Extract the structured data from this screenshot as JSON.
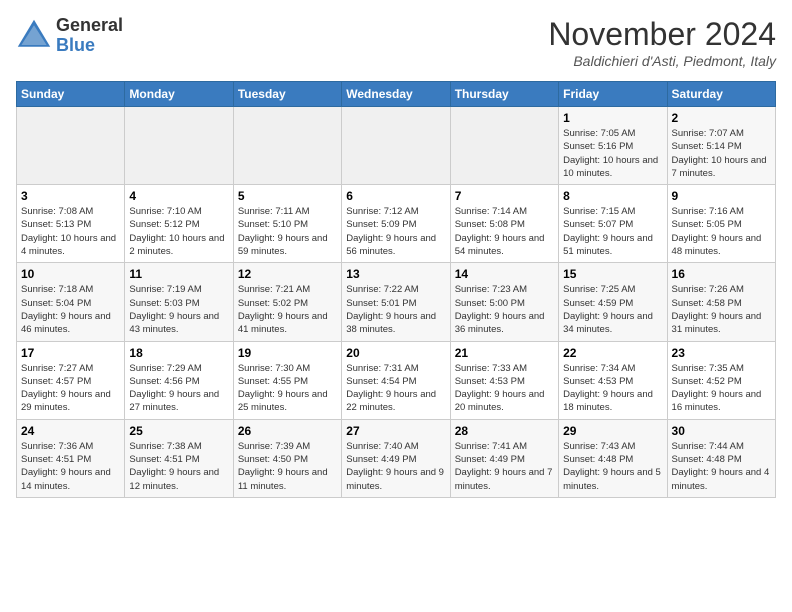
{
  "logo": {
    "line1": "General",
    "line2": "Blue"
  },
  "title": "November 2024",
  "location": "Baldichieri d'Asti, Piedmont, Italy",
  "days_of_week": [
    "Sunday",
    "Monday",
    "Tuesday",
    "Wednesday",
    "Thursday",
    "Friday",
    "Saturday"
  ],
  "weeks": [
    [
      {
        "day": "",
        "info": ""
      },
      {
        "day": "",
        "info": ""
      },
      {
        "day": "",
        "info": ""
      },
      {
        "day": "",
        "info": ""
      },
      {
        "day": "",
        "info": ""
      },
      {
        "day": "1",
        "info": "Sunrise: 7:05 AM\nSunset: 5:16 PM\nDaylight: 10 hours and 10 minutes."
      },
      {
        "day": "2",
        "info": "Sunrise: 7:07 AM\nSunset: 5:14 PM\nDaylight: 10 hours and 7 minutes."
      }
    ],
    [
      {
        "day": "3",
        "info": "Sunrise: 7:08 AM\nSunset: 5:13 PM\nDaylight: 10 hours and 4 minutes."
      },
      {
        "day": "4",
        "info": "Sunrise: 7:10 AM\nSunset: 5:12 PM\nDaylight: 10 hours and 2 minutes."
      },
      {
        "day": "5",
        "info": "Sunrise: 7:11 AM\nSunset: 5:10 PM\nDaylight: 9 hours and 59 minutes."
      },
      {
        "day": "6",
        "info": "Sunrise: 7:12 AM\nSunset: 5:09 PM\nDaylight: 9 hours and 56 minutes."
      },
      {
        "day": "7",
        "info": "Sunrise: 7:14 AM\nSunset: 5:08 PM\nDaylight: 9 hours and 54 minutes."
      },
      {
        "day": "8",
        "info": "Sunrise: 7:15 AM\nSunset: 5:07 PM\nDaylight: 9 hours and 51 minutes."
      },
      {
        "day": "9",
        "info": "Sunrise: 7:16 AM\nSunset: 5:05 PM\nDaylight: 9 hours and 48 minutes."
      }
    ],
    [
      {
        "day": "10",
        "info": "Sunrise: 7:18 AM\nSunset: 5:04 PM\nDaylight: 9 hours and 46 minutes."
      },
      {
        "day": "11",
        "info": "Sunrise: 7:19 AM\nSunset: 5:03 PM\nDaylight: 9 hours and 43 minutes."
      },
      {
        "day": "12",
        "info": "Sunrise: 7:21 AM\nSunset: 5:02 PM\nDaylight: 9 hours and 41 minutes."
      },
      {
        "day": "13",
        "info": "Sunrise: 7:22 AM\nSunset: 5:01 PM\nDaylight: 9 hours and 38 minutes."
      },
      {
        "day": "14",
        "info": "Sunrise: 7:23 AM\nSunset: 5:00 PM\nDaylight: 9 hours and 36 minutes."
      },
      {
        "day": "15",
        "info": "Sunrise: 7:25 AM\nSunset: 4:59 PM\nDaylight: 9 hours and 34 minutes."
      },
      {
        "day": "16",
        "info": "Sunrise: 7:26 AM\nSunset: 4:58 PM\nDaylight: 9 hours and 31 minutes."
      }
    ],
    [
      {
        "day": "17",
        "info": "Sunrise: 7:27 AM\nSunset: 4:57 PM\nDaylight: 9 hours and 29 minutes."
      },
      {
        "day": "18",
        "info": "Sunrise: 7:29 AM\nSunset: 4:56 PM\nDaylight: 9 hours and 27 minutes."
      },
      {
        "day": "19",
        "info": "Sunrise: 7:30 AM\nSunset: 4:55 PM\nDaylight: 9 hours and 25 minutes."
      },
      {
        "day": "20",
        "info": "Sunrise: 7:31 AM\nSunset: 4:54 PM\nDaylight: 9 hours and 22 minutes."
      },
      {
        "day": "21",
        "info": "Sunrise: 7:33 AM\nSunset: 4:53 PM\nDaylight: 9 hours and 20 minutes."
      },
      {
        "day": "22",
        "info": "Sunrise: 7:34 AM\nSunset: 4:53 PM\nDaylight: 9 hours and 18 minutes."
      },
      {
        "day": "23",
        "info": "Sunrise: 7:35 AM\nSunset: 4:52 PM\nDaylight: 9 hours and 16 minutes."
      }
    ],
    [
      {
        "day": "24",
        "info": "Sunrise: 7:36 AM\nSunset: 4:51 PM\nDaylight: 9 hours and 14 minutes."
      },
      {
        "day": "25",
        "info": "Sunrise: 7:38 AM\nSunset: 4:51 PM\nDaylight: 9 hours and 12 minutes."
      },
      {
        "day": "26",
        "info": "Sunrise: 7:39 AM\nSunset: 4:50 PM\nDaylight: 9 hours and 11 minutes."
      },
      {
        "day": "27",
        "info": "Sunrise: 7:40 AM\nSunset: 4:49 PM\nDaylight: 9 hours and 9 minutes."
      },
      {
        "day": "28",
        "info": "Sunrise: 7:41 AM\nSunset: 4:49 PM\nDaylight: 9 hours and 7 minutes."
      },
      {
        "day": "29",
        "info": "Sunrise: 7:43 AM\nSunset: 4:48 PM\nDaylight: 9 hours and 5 minutes."
      },
      {
        "day": "30",
        "info": "Sunrise: 7:44 AM\nSunset: 4:48 PM\nDaylight: 9 hours and 4 minutes."
      }
    ]
  ]
}
